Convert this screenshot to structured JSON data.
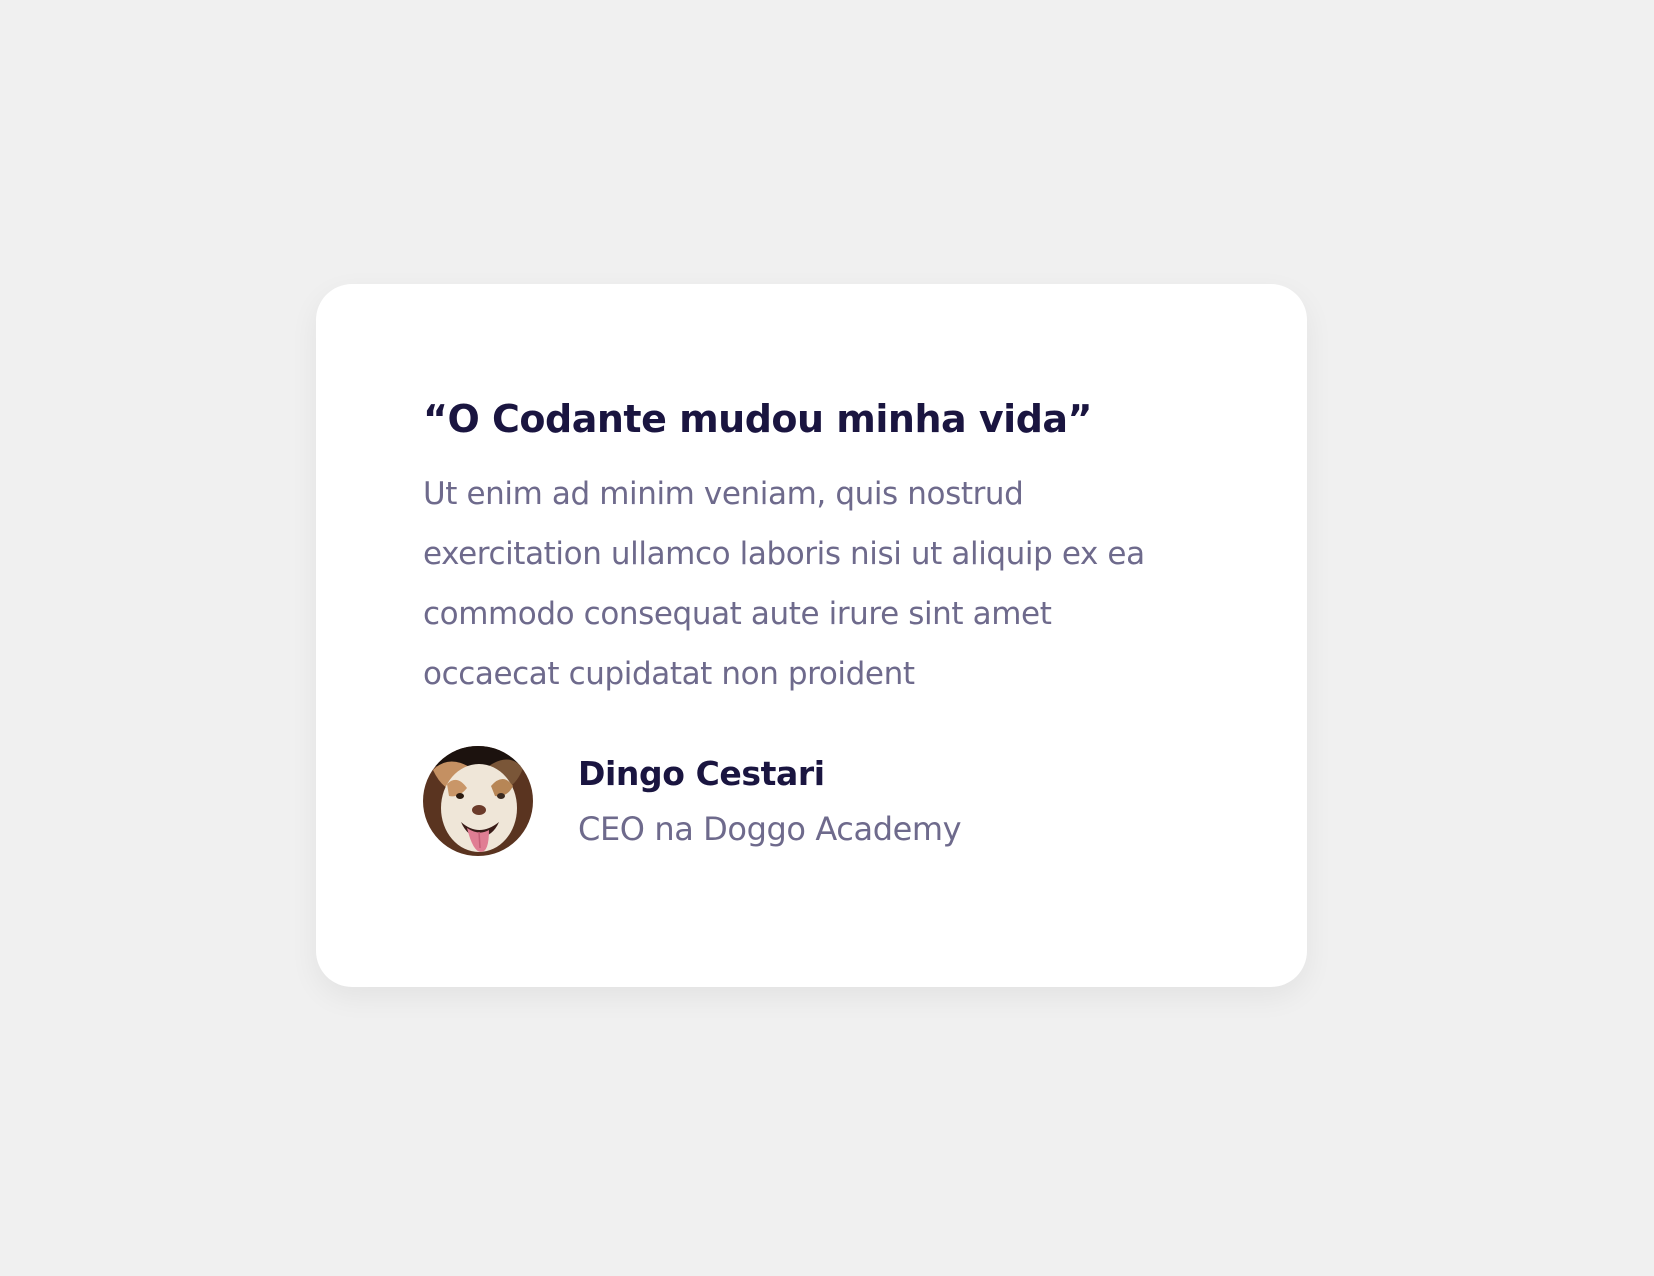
{
  "testimonial": {
    "headline": "“O Codante mudou minha vida”",
    "body": "Ut enim ad minim veniam, quis nostrud exercitation ullamco laboris nisi ut aliquip ex ea commodo consequat aute irure sint amet occaecat cupidatat non proident",
    "author": {
      "name": "Dingo Cestari",
      "role": "CEO na Doggo Academy",
      "avatar_icon": "dog-avatar"
    }
  },
  "colors": {
    "background": "#f0f0f0",
    "card": "#ffffff",
    "heading": "#1a1540",
    "muted": "#6e6a8c"
  }
}
